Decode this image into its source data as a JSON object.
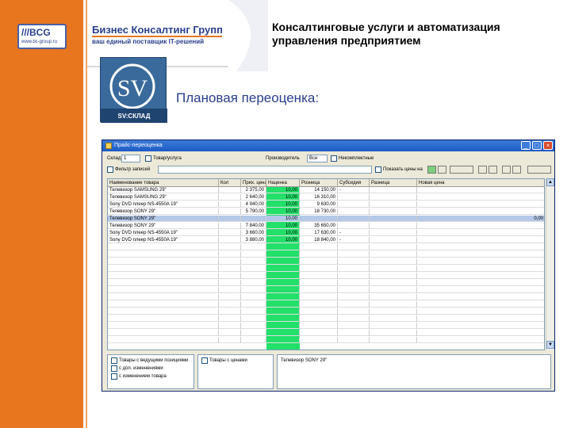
{
  "brand": {
    "logo_text": "///BCG",
    "logo_url": "www.bc-group.ru",
    "name": "Бизнес Консалтинг Групп",
    "tagline": "ваш единый поставщик IT-решений"
  },
  "slide": {
    "title": "Консалтинговые услуги и автоматизация управления предприятием",
    "subtitle": "Плановая переоценка:",
    "product_logo_text": "SV",
    "product_logo_caption": "SV:СКЛАД"
  },
  "app": {
    "window_title": "Прайс-переоценка",
    "window_buttons": [
      "_",
      "□",
      "×"
    ],
    "toolbar": {
      "row1": {
        "sklad_label": "Склад",
        "sklad_value": "1",
        "tovar_label": "Товар/услуга",
        "proizvoditel_label": "Производитель",
        "proizvoditel_value": "Все",
        "nekomplekt_label": "Некомплектные"
      },
      "row2": {
        "filter_label": "Фильтр записей",
        "filter_value": "",
        "price_label": "Показать цены на"
      }
    },
    "grid": {
      "columns": [
        "Наименование товара",
        "Кол",
        "Прих. цена",
        "Наценка",
        "Розница",
        "Субсидия",
        "Разница",
        "Новая цена"
      ],
      "rows": [
        {
          "name": "Телевизор SAMSUNG 29\"",
          "qty": "",
          "in_price": "2 375,00",
          "markup": "10,00",
          "retail": "14 150,00",
          "sub": "-",
          "diff": "",
          "new": ""
        },
        {
          "name": "Телевизор SAMSUNG 29\"",
          "qty": "",
          "in_price": "2 640,00",
          "markup": "10,00",
          "retail": "16 310,00",
          "sub": "",
          "diff": "",
          "new": ""
        },
        {
          "name": "Sony DVD плеер NS-4550A 19\"",
          "qty": "",
          "in_price": "4 940,00",
          "markup": "10,00",
          "retail": "9 630,00",
          "sub": "",
          "diff": "",
          "new": ""
        },
        {
          "name": "Телевизор SONY 29\"",
          "qty": "",
          "in_price": "5 790,00",
          "markup": "10,00",
          "retail": "18 730,00",
          "sub": "",
          "diff": "",
          "new": ""
        },
        {
          "name": "Телевизор SONY 29\"",
          "qty": "",
          "in_price": "",
          "markup": "10,00",
          "retail": "",
          "sub": "",
          "diff": "",
          "new": "0,00",
          "selected": true
        },
        {
          "name": "Телевизор SONY 29\"",
          "qty": "",
          "in_price": "7 840,00",
          "markup": "10,00",
          "retail": "35 650,00",
          "sub": "",
          "diff": "",
          "new": ""
        },
        {
          "name": "Sony DVD плеер NS-4550A 19\"",
          "qty": "",
          "in_price": "3 660,00",
          "markup": "10,00",
          "retail": "17 630,00",
          "sub": "-",
          "diff": "",
          "new": ""
        },
        {
          "name": "Sony DVD плеер NS-4550A 19\"",
          "qty": "",
          "in_price": "3 880,00",
          "markup": "10,00",
          "retail": "18 840,00",
          "sub": "-",
          "diff": "",
          "new": ""
        }
      ]
    },
    "bottom": {
      "opt1": "Товары с ведущими позициями",
      "opt2": "с доп. изменениями",
      "opt3": "с изменением товара",
      "opt4": "Товары с ценами",
      "preview": "Телевизор SONY 29\""
    }
  },
  "colors": {
    "orange": "#e8761e",
    "brand_blue": "#2a3f8c",
    "markup_green": "#22e06a"
  }
}
